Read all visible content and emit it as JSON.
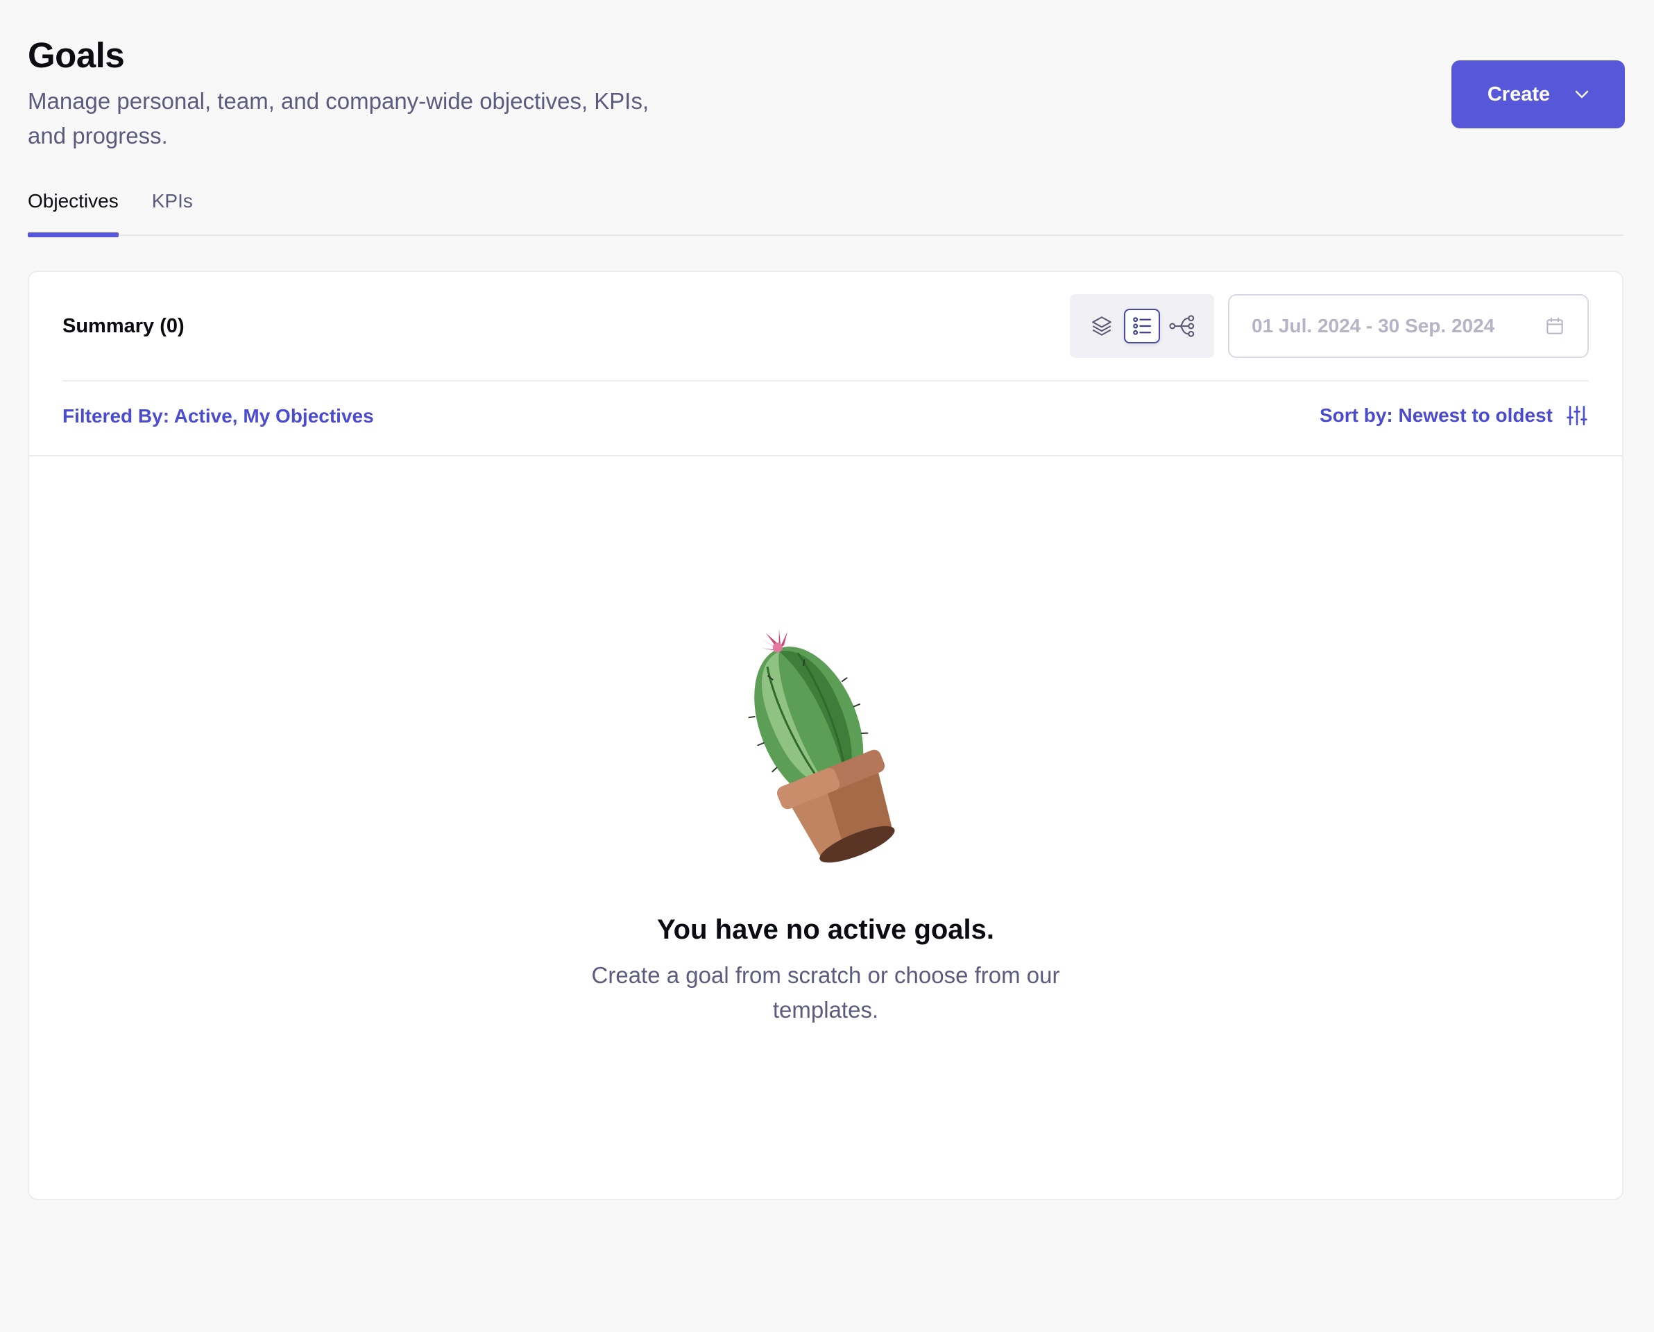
{
  "header": {
    "title": "Goals",
    "subtitle": "Manage personal, team, and company-wide objectives, KPIs, and progress.",
    "create_label": "Create"
  },
  "tabs": [
    {
      "label": "Objectives",
      "active": true
    },
    {
      "label": "KPIs",
      "active": false
    }
  ],
  "summary": {
    "label": "Summary (0)",
    "view_modes": [
      "layers-icon",
      "list-icon",
      "hierarchy-icon"
    ],
    "active_view": "list-icon",
    "date_range": "01 Jul. 2024 - 30 Sep. 2024"
  },
  "filters": {
    "filter_text": "Filtered By: Active, My Objectives",
    "sort_text": "Sort by: Newest to oldest"
  },
  "empty_state": {
    "title": "You have no active goals.",
    "description": "Create a goal from scratch or choose from our templates."
  },
  "colors": {
    "accent": "#5757d9",
    "link": "#4b4bcf",
    "muted_text": "#5c5b7e",
    "background": "#f8f8f9"
  }
}
